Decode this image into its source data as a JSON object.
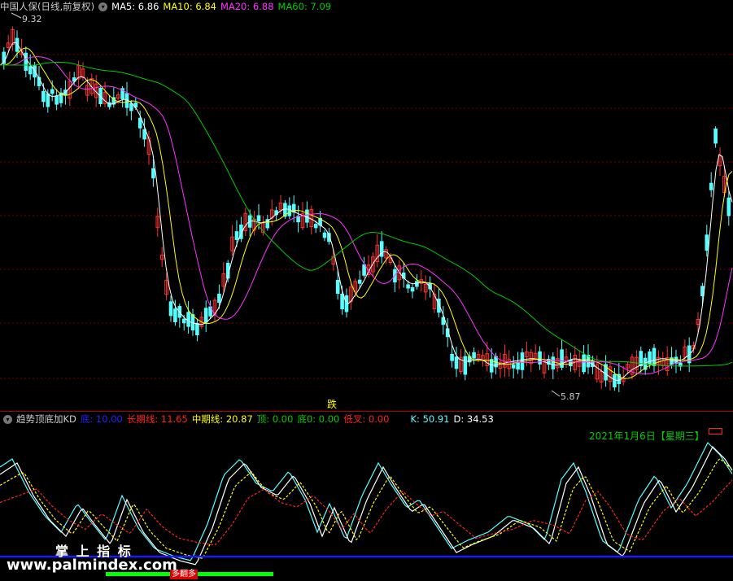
{
  "main_chart": {
    "stock_name": "中国人保(日线,前复权)",
    "ma": [
      {
        "label": "MA5: 6.86",
        "color": "#ffffff"
      },
      {
        "label": "MA10: 6.84",
        "color": "#ffff00"
      },
      {
        "label": "MA20: 6.88",
        "color": "#ff33ff"
      },
      {
        "label": "MA60: 7.09",
        "color": "#00cc00"
      }
    ],
    "high_label": "9.32",
    "low_label": "5.87",
    "signal_label": "跌",
    "up_color": "#ff3333",
    "down_color": "#55ffff"
  },
  "indicator": {
    "name": "趋势顶底加KD",
    "values": [
      {
        "label": "底: 10.00",
        "color": "#2222ff"
      },
      {
        "label": "长期线: 11.65",
        "color": "#ff2222"
      },
      {
        "label": "中期线: 20.87",
        "color": "#ffff00"
      },
      {
        "label": "顶: 0.00",
        "color": "#00cc00"
      },
      {
        "label": "底0: 0.00",
        "color": "#00cc00"
      },
      {
        "label": "低叉: 0.00",
        "color": "#ff2222"
      },
      {
        "label": "K: 50.91",
        "color": "#55ffff"
      },
      {
        "label": "D: 34.53",
        "color": "#ffffff"
      }
    ],
    "date_label": "2021年1月6日【星期三】",
    "bottom_tag": "多翻多"
  },
  "watermark": {
    "title": "掌 上 指 标",
    "url": "www.palmindex.com"
  }
}
